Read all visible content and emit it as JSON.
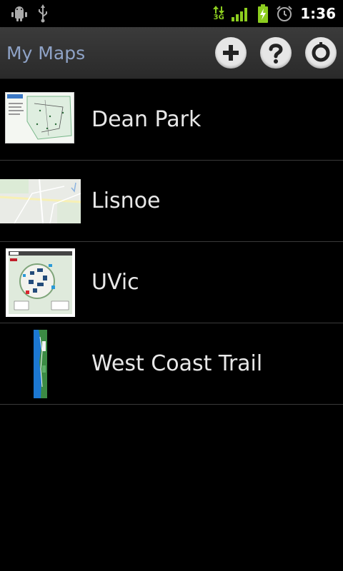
{
  "statusbar": {
    "left_icons": [
      "android-debug-icon",
      "usb-icon"
    ],
    "network": "3G",
    "right_icons": [
      "data-transfer-icon",
      "signal-icon",
      "battery-charging-icon",
      "alarm-icon"
    ],
    "time": "1:36"
  },
  "actionbar": {
    "title": "My Maps",
    "actions": [
      {
        "icon": "add-icon"
      },
      {
        "icon": "help-icon"
      },
      {
        "icon": "settings-icon"
      }
    ]
  },
  "maps": [
    {
      "name": "Dean Park"
    },
    {
      "name": "Lisnoe"
    },
    {
      "name": "UVic"
    },
    {
      "name": "West Coast Trail"
    }
  ],
  "colors": {
    "title": "#8fa3c7",
    "signal_green": "#8ccd1f",
    "list_text": "#e8e8e8"
  }
}
